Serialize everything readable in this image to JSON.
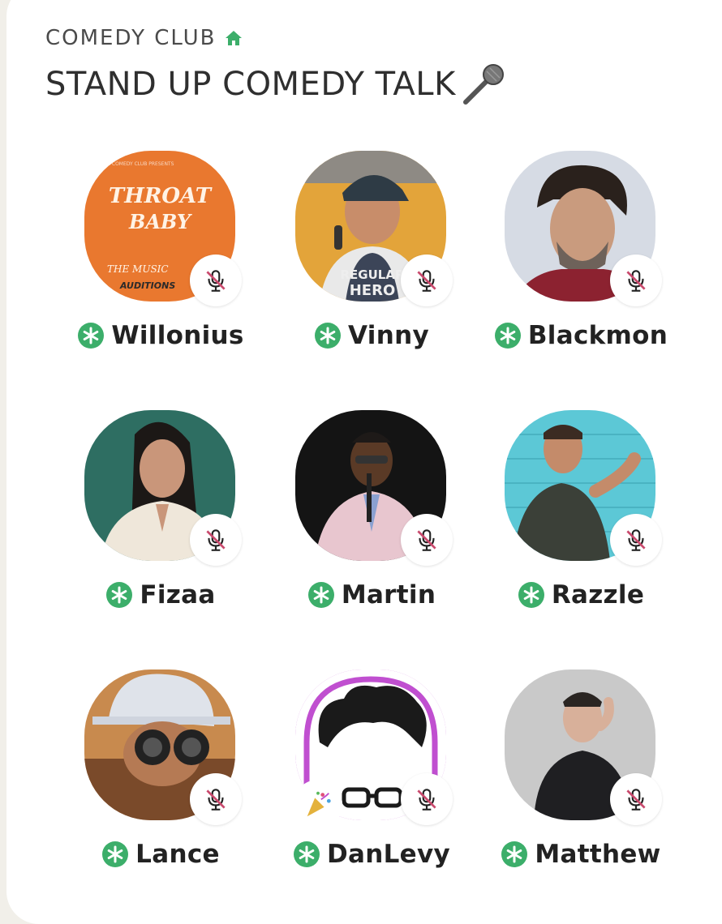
{
  "club": {
    "name": "COMEDY CLUB",
    "icon": "home-icon",
    "icon_color": "#3cae6a"
  },
  "room": {
    "title": "STAND UP COMEDY TALK",
    "emoji": "microphone-emoji"
  },
  "colors": {
    "member_badge": "#3cae6a",
    "mute_slash": "#c94a6d",
    "ring": "#c04fd0"
  },
  "speakers": [
    {
      "name": "Willonius",
      "muted": true,
      "avatar_text": [
        "THROAT",
        "BABY",
        "THE MUSIC",
        "AUDITIONS"
      ]
    },
    {
      "name": "Vinny",
      "muted": true,
      "avatar_text": [
        "REGULAR",
        "HERO"
      ]
    },
    {
      "name": "Blackmon",
      "muted": true
    },
    {
      "name": "Fizaa",
      "muted": true
    },
    {
      "name": "Martin",
      "muted": true
    },
    {
      "name": "Razzle",
      "muted": true
    },
    {
      "name": "Lance",
      "muted": true
    },
    {
      "name": "DanLevy",
      "muted": true,
      "badge": "party-popper-icon"
    },
    {
      "name": "Matthew",
      "muted": true
    }
  ]
}
